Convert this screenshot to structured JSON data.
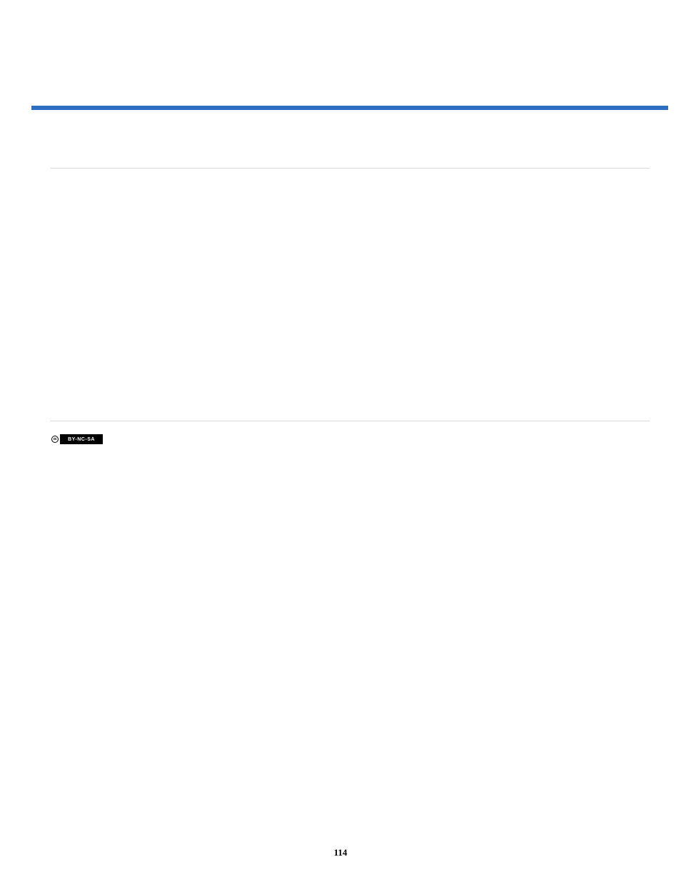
{
  "page": {
    "number": "114"
  },
  "cc_badge": {
    "cc_text": "cc",
    "label": "BY-NC-SA"
  }
}
